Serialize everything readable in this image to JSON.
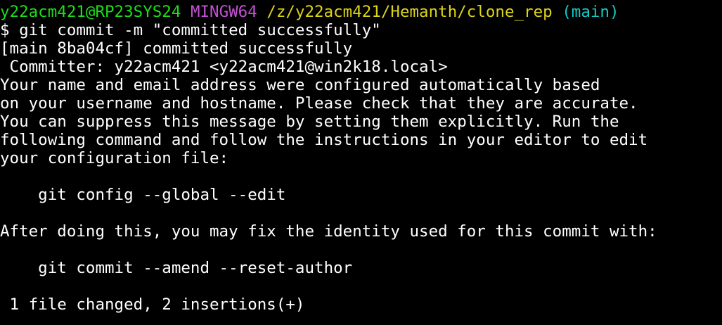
{
  "prompt": {
    "user_host": "y22acm421@RP23SYS24",
    "system": "MINGW64",
    "cwd": "/z/y22acm421/Hemanth/clone_rep",
    "branch": "(main)",
    "symbol": "$",
    "command": "git commit -m \"committed successfully\""
  },
  "output": {
    "lines": [
      "[main 8ba04cf] committed successfully",
      " Committer: y22acm421 <y22acm421@win2k18.local>",
      "Your name and email address were configured automatically based",
      "on your username and hostname. Please check that they are accurate.",
      "You can suppress this message by setting them explicitly. Run the",
      "following command and follow the instructions in your editor to edit",
      "your configuration file:",
      "",
      "    git config --global --edit",
      "",
      "After doing this, you may fix the identity used for this commit with:",
      "",
      "    git commit --amend --reset-author",
      "",
      " 1 file changed, 2 insertions(+)"
    ]
  },
  "colors": {
    "background": "#000000",
    "user_host": "#1ddd1a",
    "system": "#c44fd6",
    "path": "#dcd31a",
    "branch": "#14c9c6",
    "text": "#ffffff"
  }
}
